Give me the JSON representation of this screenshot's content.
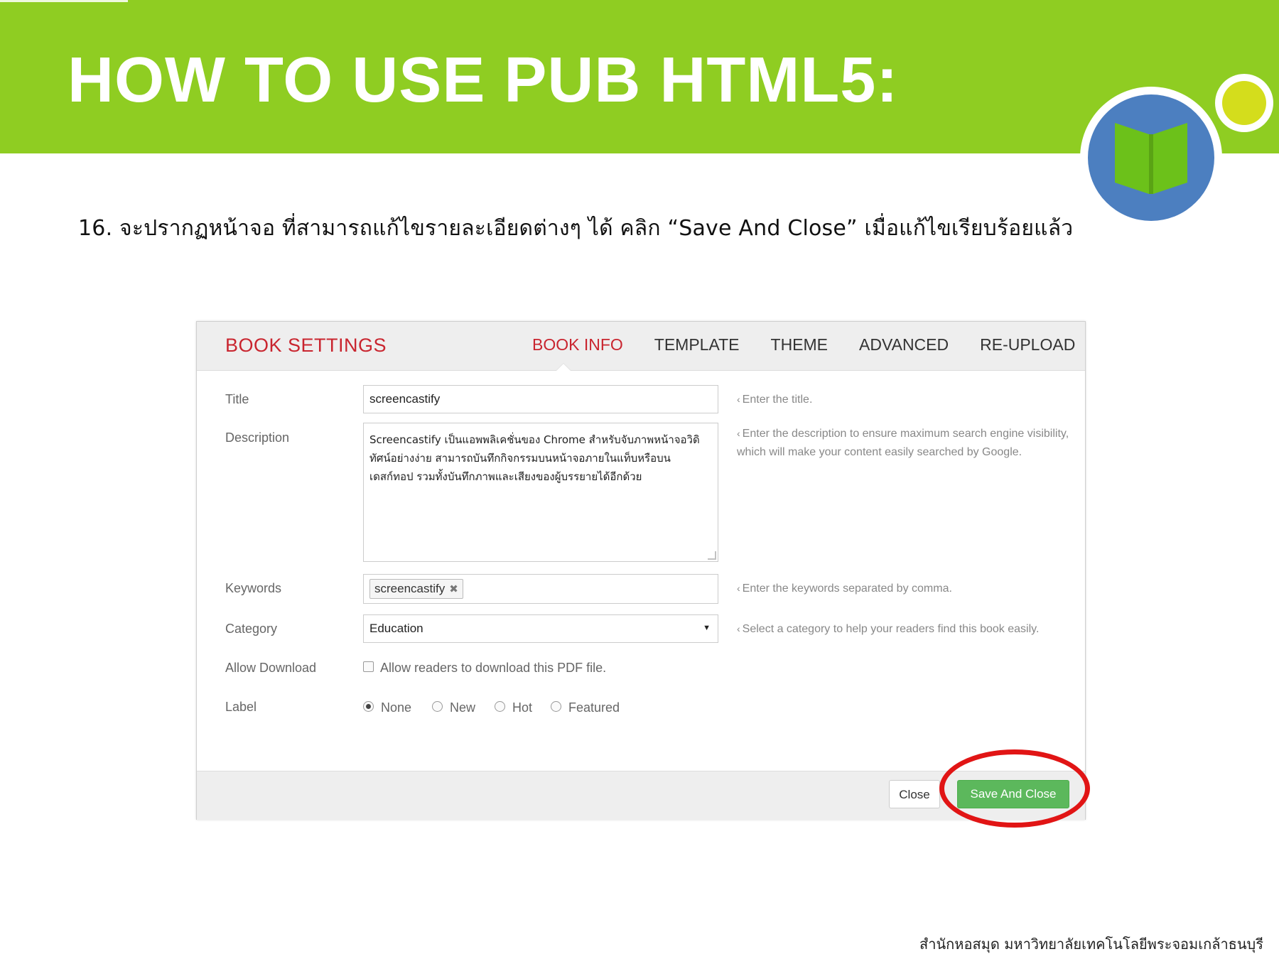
{
  "slide": {
    "title": "HOW TO USE PUB HTML5:",
    "instruction": "16. จะปรากฏหน้าจอ ที่สามารถแก้ไขรายละเอียดต่างๆ ได้ คลิก “Save And Close” เมื่อแก้ไขเรียบร้อยแล้ว",
    "footer_credit": "สำนักหอสมุด มหาวิทยาลัยเทคโนโลยีพระจอมเกล้าธนบุรี",
    "colors": {
      "banner": "#8fcd22",
      "logo_circle": "#4c7fc0",
      "logo_book": "#6cc11a",
      "logo_dot": "#d4dd1c",
      "highlight": "#e11515"
    },
    "logo_icon": "open-book-icon"
  },
  "dialog": {
    "title": "BOOK SETTINGS",
    "tabs": [
      {
        "label": "BOOK INFO",
        "active": true
      },
      {
        "label": "TEMPLATE",
        "active": false
      },
      {
        "label": "THEME",
        "active": false
      },
      {
        "label": "ADVANCED",
        "active": false
      },
      {
        "label": "RE-UPLOAD",
        "active": false
      }
    ],
    "fields": {
      "title": {
        "label": "Title",
        "value": "screencastify",
        "hint": "Enter the title."
      },
      "description": {
        "label": "Description",
        "value": "Screencastify เป็นแอพพลิเคชั่นของ Chrome สำหรับจับภาพหน้าจอวิดิทัศน์อย่างง่าย สามารถบันทึกกิจกรรมบนหน้าจอภายในแท็บหรือบนเดสก์ทอป รวมทั้งบันทึกภาพและเสียงของผู้บรรยายได้อีกด้วย",
        "hint": "Enter the description to ensure maximum search engine visibility, which will make your content easily searched by Google."
      },
      "keywords": {
        "label": "Keywords",
        "tag": "screencastify",
        "tag_remove_icon": "✖",
        "hint": "Enter the keywords separated by comma."
      },
      "category": {
        "label": "Category",
        "value": "Education",
        "arrow": "▼",
        "hint": "Select a category to help your readers find this book easily."
      },
      "allow_download": {
        "label": "Allow Download",
        "checkbox_label": "Allow readers to download this PDF file.",
        "checked": false
      },
      "label": {
        "label": "Label",
        "options": [
          {
            "label": "None",
            "selected": true
          },
          {
            "label": "New",
            "selected": false
          },
          {
            "label": "Hot",
            "selected": false
          },
          {
            "label": "Featured",
            "selected": false
          }
        ]
      }
    },
    "hint_chevron": "‹",
    "buttons": {
      "close": "Close",
      "save_and_close": "Save And Close"
    }
  }
}
